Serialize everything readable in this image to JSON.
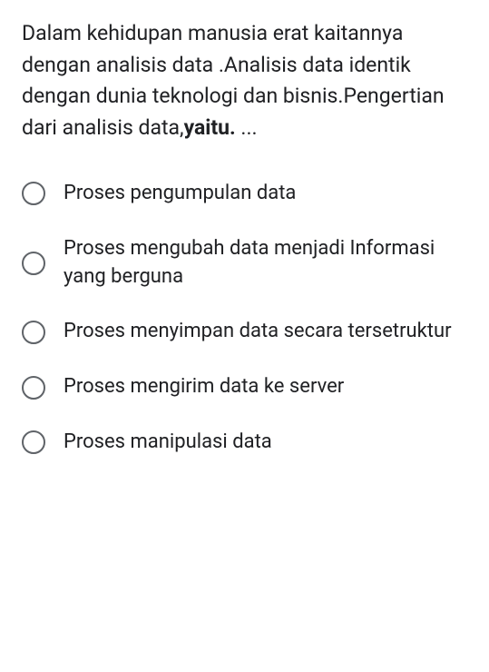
{
  "question": {
    "text_part1": "Dalam kehidupan manusia erat kaitannya dengan analisis data .Analisis data identik dengan dunia teknologi dan bisnis.Pengertian dari analisis data,",
    "text_bold": "yaitu.",
    "text_part2": " ..."
  },
  "options": [
    {
      "label": "Proses pengumpulan data"
    },
    {
      "label": "Proses mengubah data menjadi Informasi yang berguna"
    },
    {
      "label": "Proses menyimpan data secara tersetruktur"
    },
    {
      "label": "Proses mengirim data ke server"
    },
    {
      "label": "Proses manipulasi data"
    }
  ]
}
